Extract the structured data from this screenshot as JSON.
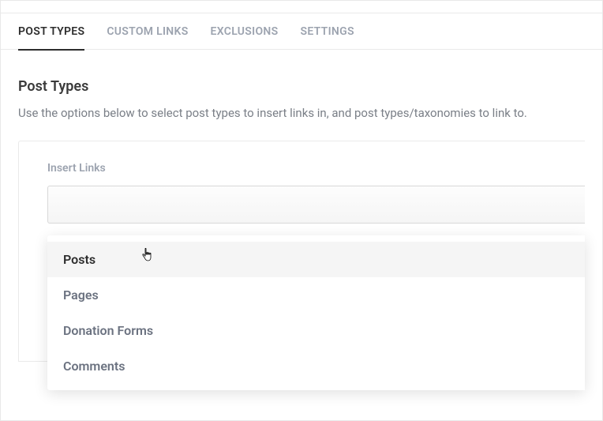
{
  "tabs": {
    "post_types": "POST TYPES",
    "custom_links": "CUSTOM LINKS",
    "exclusions": "EXCLUSIONS",
    "settings": "SETTINGS"
  },
  "section": {
    "title": "Post Types",
    "description": "Use the options below to select post types to insert links in, and post types/taxonomies to link to."
  },
  "field": {
    "label": "Insert Links"
  },
  "dropdown": {
    "options": {
      "posts": "Posts",
      "pages": "Pages",
      "donation_forms": "Donation Forms",
      "comments": "Comments"
    }
  }
}
